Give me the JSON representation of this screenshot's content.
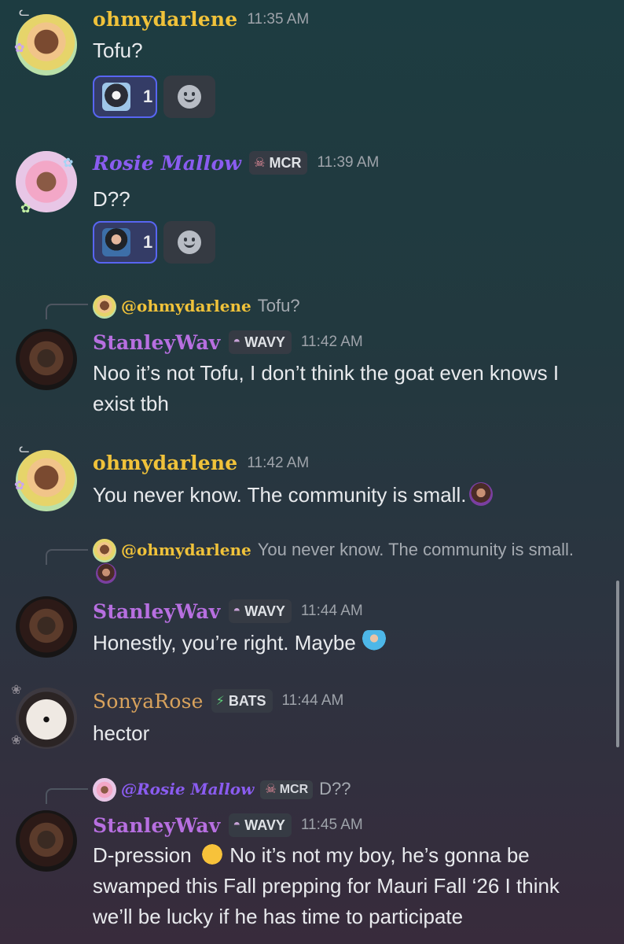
{
  "messages": [
    {
      "author": "ohmydarlene",
      "time": "11:35 AM",
      "text": "Tofu?",
      "reaction_count": "1"
    },
    {
      "author": "Rosie Mallow",
      "tag": "MCR",
      "time": "11:39 AM",
      "text": "D??",
      "reaction_count": "1"
    },
    {
      "reply_to": {
        "author": "@ohmydarlene",
        "text": "Tofu?"
      },
      "author": "StanleyWav",
      "tag": "WAVY",
      "time": "11:42 AM",
      "text": "Noo it’s not Tofu, I don’t think the goat even knows I exist tbh"
    },
    {
      "author": "ohmydarlene",
      "time": "11:42 AM",
      "text": "You never know. The community is small."
    },
    {
      "reply_to": {
        "author": "@ohmydarlene",
        "text": "You never know. The community is small."
      },
      "author": "StanleyWav",
      "tag": "WAVY",
      "time": "11:44 AM",
      "text": "Honestly, you’re right. Maybe"
    },
    {
      "author": "SonyaRose",
      "tag": "BATS",
      "time": "11:44 AM",
      "text": "hector"
    },
    {
      "reply_to": {
        "author": "@Rosie Mallow",
        "tag": "MCR",
        "text": "D??"
      },
      "author": "StanleyWav",
      "tag": "WAVY",
      "time": "11:45 AM",
      "text": "D-pression",
      "text_after": "No it’s not my boy, he’s gonna be swamped this Fall prepping for Mauri Fall ‘26 I think we’ll be lucky if he has time to participate"
    }
  ],
  "icons": {
    "tag_mcr": "skull-icon",
    "tag_wavy": "onion-icon",
    "tag_bats": "lightning-icon",
    "add_reaction": "smiley-icon"
  },
  "colors": {
    "darlene": "#f0c23a",
    "rosie": "#8a5cf0",
    "stanley": "#b76fe0",
    "sonya": "#d8a25c",
    "reaction_border": "#5865f2"
  }
}
